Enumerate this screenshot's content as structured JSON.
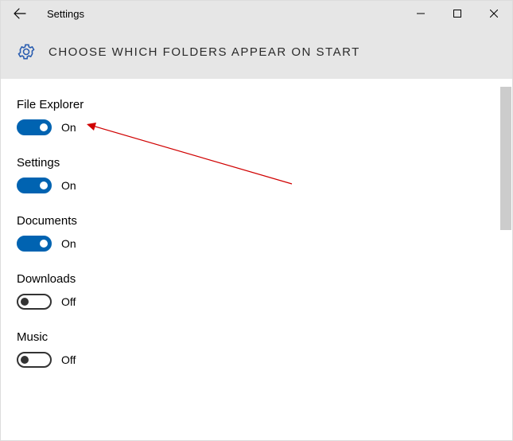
{
  "window": {
    "title": "Settings"
  },
  "header": {
    "title": "CHOOSE WHICH FOLDERS APPEAR ON START"
  },
  "toggle_states": {
    "on": "On",
    "off": "Off"
  },
  "items": [
    {
      "label": "File Explorer",
      "on": true
    },
    {
      "label": "Settings",
      "on": true
    },
    {
      "label": "Documents",
      "on": true
    },
    {
      "label": "Downloads",
      "on": false
    },
    {
      "label": "Music",
      "on": false
    }
  ]
}
